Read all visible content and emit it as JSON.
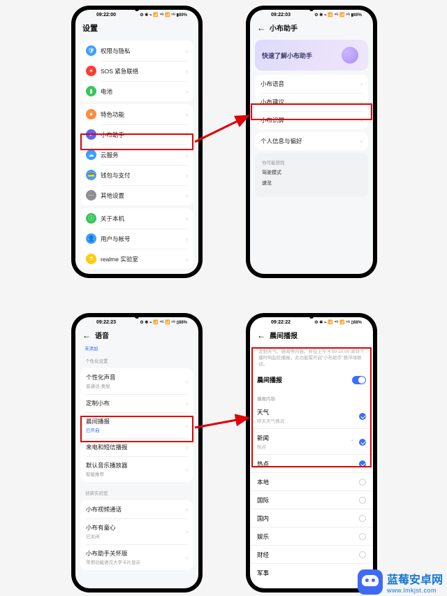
{
  "status": {
    "t1": "09:22:00",
    "t2": "09:22:03",
    "t3": "09:22:23",
    "t4": "09:22:22",
    "ind": "⚙ ✱ ⌁ 📶 ⁴ᴳ 📶 ⁵ᴳ ▮89%",
    "ind2": "⚙ ✱ ⌁ 📶 ⁴ᴳ 📶 ⁵ᴳ ▯88%"
  },
  "p1": {
    "title": "设置",
    "rows_a": [
      {
        "name": "privacy",
        "icon_bg": "#3aa0ff",
        "icon": "🛡",
        "label": "权限与隐私"
      },
      {
        "name": "sos",
        "icon_bg": "#ff3b30",
        "icon": "✶",
        "label": "SOS 紧急联络"
      },
      {
        "name": "battery",
        "icon_bg": "#34c759",
        "icon": "▮",
        "label": "电池"
      }
    ],
    "rows_b": [
      {
        "name": "features",
        "icon_bg": "#ff8a3d",
        "icon": "★",
        "label": "特色功能"
      },
      {
        "name": "assistant",
        "icon_bg": "#5a67f5",
        "icon": "◐",
        "label": "小布助手"
      },
      {
        "name": "cloud",
        "icon_bg": "#3aa0ff",
        "icon": "☁",
        "label": "云服务"
      },
      {
        "name": "wallet",
        "icon_bg": "#3aa0ff",
        "icon": "💳",
        "label": "钱包与支付"
      },
      {
        "name": "other",
        "icon_bg": "#8e8e93",
        "icon": "⋯",
        "label": "其他设置"
      }
    ],
    "rows_c": [
      {
        "name": "about",
        "icon_bg": "#34c759",
        "icon": "ⓘ",
        "label": "关于本机"
      },
      {
        "name": "account",
        "icon_bg": "#3aa0ff",
        "icon": "👤",
        "label": "用户与帐号"
      },
      {
        "name": "lab",
        "icon_bg": "#ffcc00",
        "icon": "⚗",
        "label": "realme 实验室"
      }
    ]
  },
  "p2": {
    "title": "小布助手",
    "banner": "快速了解小布助手",
    "rows_a": [
      {
        "name": "voice",
        "label": "小布语音"
      },
      {
        "name": "suggest",
        "label": "小布建议"
      },
      {
        "name": "screen",
        "label": "小布识屏"
      }
    ],
    "rows_b": [
      {
        "name": "pref",
        "label": "个人信息与偏好"
      }
    ],
    "hint_title": "你可能想找",
    "hints": [
      "驾驶模式",
      "速览"
    ]
  },
  "p3": {
    "title": "语音",
    "sub0": "未添加",
    "grp1": "个性化设置",
    "rows_a": [
      {
        "name": "voice-personal",
        "label": "个性化声音",
        "sub": "普通话·奥梨"
      },
      {
        "name": "custom",
        "label": "定制小布"
      },
      {
        "name": "morning",
        "label": "晨间播报",
        "sub": "已开启",
        "accent": true
      },
      {
        "name": "sms",
        "label": "来电和短信播报"
      },
      {
        "name": "player",
        "label": "默认音乐播放器",
        "sub": "智能推荐"
      }
    ],
    "grp2": "创新实验室",
    "rows_b": [
      {
        "name": "video-call",
        "label": "小布视频通话"
      },
      {
        "name": "heart",
        "label": "小布有童心",
        "sub": "已关闭",
        "accent": false
      },
      {
        "name": "care",
        "label": "小布助手关怀版",
        "sub": "常用功能语汉大字卡片显示"
      }
    ]
  },
  "p4": {
    "title": "晨间播报",
    "desc": "定制天气、新闻等内容，并在上午 4:00-10:00 闹铃个播时响起处播报。此功能需开启\"小布助手\"悬浮球联动。",
    "toggle_label": "晨间播报",
    "grp": "播报内容",
    "items": [
      {
        "name": "weather",
        "label": "天气",
        "sub": "昨天天气情况",
        "on": true,
        "sub_show": true
      },
      {
        "name": "news",
        "label": "新闻",
        "sub": "热点",
        "on": true,
        "sub_show": true,
        "expand": true
      },
      {
        "name": "hot",
        "label": "热点",
        "on": true
      },
      {
        "name": "local",
        "label": "本地",
        "on": false
      },
      {
        "name": "intl",
        "label": "国际",
        "on": false
      },
      {
        "name": "dom",
        "label": "国内",
        "on": false
      },
      {
        "name": "ent",
        "label": "娱乐",
        "on": false
      },
      {
        "name": "fin",
        "label": "财经",
        "on": false
      },
      {
        "name": "mil",
        "label": "军事",
        "on": false
      }
    ]
  },
  "wm": {
    "name": "蓝莓安卓网",
    "url": "www.lmkjst.com"
  }
}
